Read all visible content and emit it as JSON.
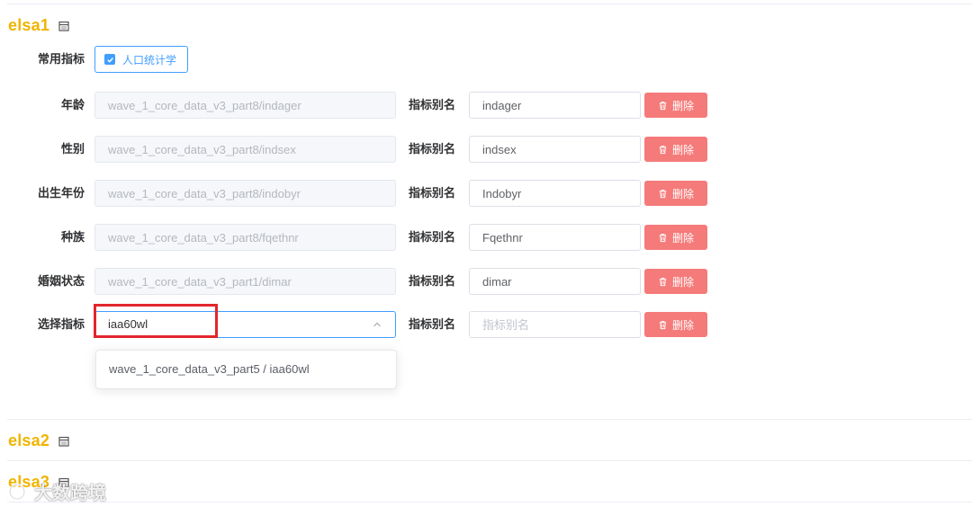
{
  "sections": [
    {
      "name": "elsa1"
    },
    {
      "name": "elsa2"
    },
    {
      "name": "elsa3"
    }
  ],
  "common": {
    "label": "常用指标",
    "tag": "人口统计学"
  },
  "alias_label": "指标别名",
  "delete_label": "删除",
  "rows": [
    {
      "label": "年龄",
      "path": "wave_1_core_data_v3_part8/indager",
      "alias": "indager"
    },
    {
      "label": "性别",
      "path": "wave_1_core_data_v3_part8/indsex",
      "alias": "indsex"
    },
    {
      "label": "出生年份",
      "path": "wave_1_core_data_v3_part8/indobyr",
      "alias": "Indobyr"
    },
    {
      "label": "种族",
      "path": "wave_1_core_data_v3_part8/fqethnr",
      "alias": "Fqethnr"
    },
    {
      "label": "婚姻状态",
      "path": "wave_1_core_data_v3_part1/dimar",
      "alias": "dimar"
    }
  ],
  "select_row": {
    "label": "选择指标",
    "value": "iaa60wl",
    "alias_placeholder": "指标别名"
  },
  "dropdown": {
    "options": [
      "wave_1_core_data_v3_part5 / iaa60wl"
    ]
  },
  "watermark": {
    "text": "大数跨境"
  },
  "colors": {
    "section_title": "#f0b400",
    "primary": "#409eff",
    "danger": "#f56c6c",
    "highlight": "#e1262c"
  }
}
